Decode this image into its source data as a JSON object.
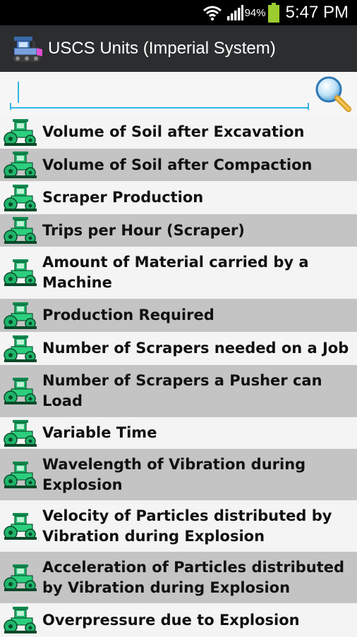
{
  "status_bar": {
    "icons": [
      "wifi-icon",
      "signal-icon",
      "battery-icon"
    ],
    "battery_percent": "94%",
    "time": "5:47 PM"
  },
  "action_bar": {
    "app_icon": "bulldozer-icon",
    "title": "USCS Units (Imperial System)"
  },
  "search": {
    "value": "",
    "placeholder": "",
    "button_icon": "magnifier-icon"
  },
  "colors": {
    "status_bar": "#000000",
    "action_bar": "#2b2d2f",
    "row_light": "#f4f4f4",
    "row_dark": "#c4c4c4",
    "accent": "#33b5e5",
    "icon_green": "#1fb56a"
  },
  "list": {
    "row_icon": "compactor-icon",
    "items": [
      {
        "label": "Volume of Soil after Excavation"
      },
      {
        "label": "Volume of Soil after Compaction"
      },
      {
        "label": "Scraper Production"
      },
      {
        "label": "Trips per Hour (Scraper)"
      },
      {
        "label": "Amount of Material carried by a Machine"
      },
      {
        "label": "Production Required"
      },
      {
        "label": "Number of Scrapers needed on a Job"
      },
      {
        "label": "Number of Scrapers a Pusher can Load"
      },
      {
        "label": "Variable Time"
      },
      {
        "label": "Wavelength of Vibration during Explosion"
      },
      {
        "label": "Velocity of Particles distributed by Vibration during Explosion"
      },
      {
        "label": "Acceleration of Particles distributed by Vibration during Explosion"
      },
      {
        "label": "Overpressure due to Explosion"
      }
    ]
  }
}
